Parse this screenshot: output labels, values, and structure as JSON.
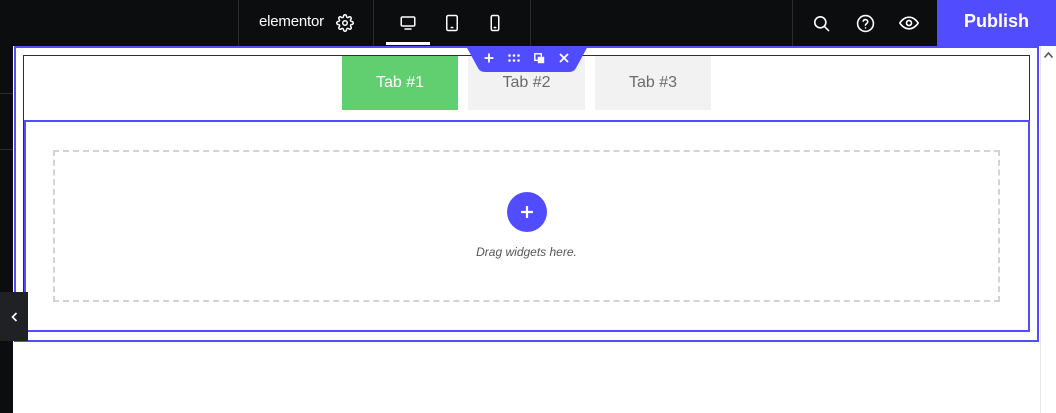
{
  "topbar": {
    "brand": "elementor",
    "publish_label": "Publish",
    "icons": [
      "settings-gear-icon",
      "desktop-icon",
      "tablet-icon",
      "mobile-icon",
      "search-icon",
      "help-icon",
      "preview-eye-icon"
    ]
  },
  "tabs": [
    {
      "label": "Tab #1",
      "active": true
    },
    {
      "label": "Tab #2",
      "active": false
    },
    {
      "label": "Tab #3",
      "active": false
    }
  ],
  "dropzone": {
    "text": "Drag widgets here."
  },
  "colors": {
    "accent": "#524cff",
    "tab_active": "#61ce70",
    "tab_inactive": "#f2f2f3",
    "topbar_bg": "#0c0d0e"
  }
}
